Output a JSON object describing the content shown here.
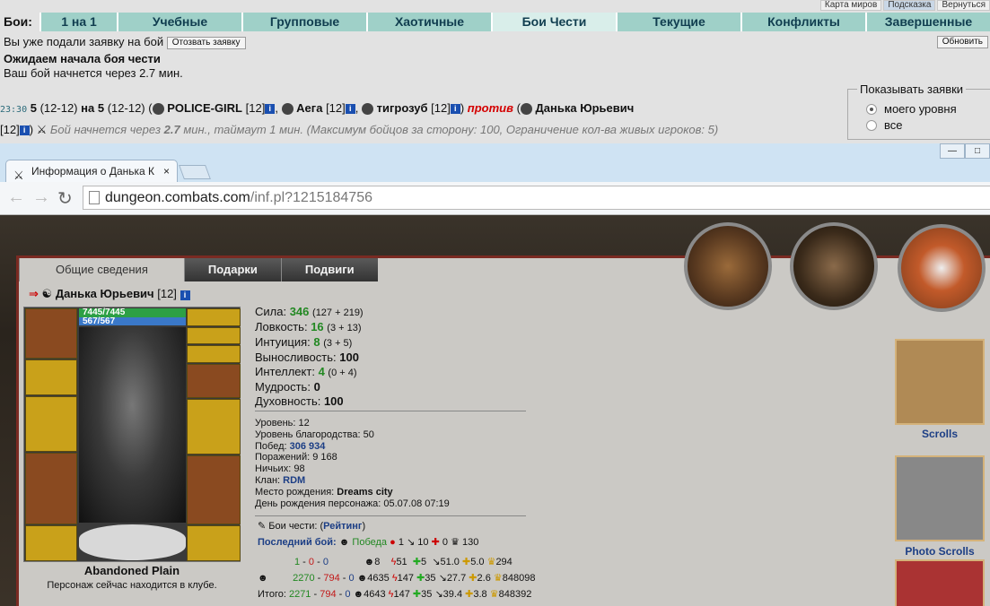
{
  "top_links": [
    {
      "label": "Карта миров",
      "active": false
    },
    {
      "label": "Подсказка",
      "active": true
    },
    {
      "label": "Вернуться",
      "active": false
    }
  ],
  "battles_tabs": {
    "label": "Бои:",
    "items": [
      "1 на 1",
      "Учебные",
      "Групповые",
      "Хаотичные",
      "Бои Чести",
      "Текущие",
      "Конфликты",
      "Завершенные"
    ],
    "selected": "Бои Чести"
  },
  "status": {
    "already_applied": "Вы уже подали заявку на бой",
    "withdraw_button": "Отозвать заявку",
    "refresh_button": "Обновить",
    "waiting_title": "Ожидаем начала боя чести",
    "start_in": "Ваш бой начнется через 2.7 мин."
  },
  "battle_request": {
    "time": "23:30",
    "teams": "5",
    "team_range": "(12-12)",
    "on": "на",
    "players_left": [
      {
        "name": "POLICE-GIRL",
        "level": "[12]"
      },
      {
        "name": "Аега",
        "level": "[12]"
      },
      {
        "name": "тигрозуб",
        "level": "[12]"
      }
    ],
    "vs": "против",
    "players_right": [
      {
        "name": "Данька Юрьевич",
        "level": "[12]"
      }
    ],
    "note_prefix": "Бой начнется через",
    "note_value": "2.7",
    "note_suffix": "мин., таймаут 1 мин. (Максимум бойцов за сторону: 100, Ограничение кол-ва живых игроков: 5)"
  },
  "show_requests": {
    "legend": "Показывать заявки",
    "options": [
      {
        "label": "моего уровня",
        "checked": true
      },
      {
        "label": "все",
        "checked": false
      }
    ]
  },
  "browser": {
    "tab_title": "Информация о Данька К",
    "tab_close": "×",
    "url_host": "dungeon.combats.com",
    "url_path": "/inf.pl?1215184756"
  },
  "profile": {
    "tabs": [
      "Общие сведения",
      "Подарки",
      "Подвиги"
    ],
    "selected_tab": "Общие сведения",
    "name": "Данька Юрьевич",
    "level": "[12]",
    "hp": "7445/7445",
    "mp": "567/567",
    "location": "Abandoned Plain",
    "location_note": "Персонаж сейчас находится в клубе.",
    "stats": [
      {
        "label": "Сила:",
        "value": "346",
        "extra": "(127 + 219)"
      },
      {
        "label": "Ловкость:",
        "value": "16",
        "extra": "(3 + 13)"
      },
      {
        "label": "Интуиция:",
        "value": "8",
        "extra": "(3 + 5)"
      },
      {
        "label": "Выносливость:",
        "value": "100",
        "extra": ""
      },
      {
        "label": "Интеллект:",
        "value": "4",
        "extra": "(0 + 4)"
      },
      {
        "label": "Мудрость:",
        "value": "0",
        "extra": ""
      },
      {
        "label": "Духовность:",
        "value": "100",
        "extra": ""
      }
    ],
    "info": [
      {
        "label": "Уровень:",
        "value": "12"
      },
      {
        "label": "Уровень благородства:",
        "value": "50"
      },
      {
        "label": "Побед:",
        "value": "306 934"
      },
      {
        "label": "Поражений:",
        "value": "9 168"
      },
      {
        "label": "Ничьих:",
        "value": "98"
      },
      {
        "label": "Клан:",
        "value": "RDM"
      },
      {
        "label": "Место рождения:",
        "value": "Dreams city"
      },
      {
        "label": "День рождения персонажа:",
        "value": "05.07.08 07:19"
      }
    ],
    "honor_label": "Бои чести:",
    "honor_link": "Рейтинг",
    "last_battle_label": "Последний бой:",
    "last_battle_result": "Победа",
    "last_battle_vals": [
      "1",
      "10",
      "0",
      "130"
    ],
    "score_rows": [
      {
        "a": "1",
        "b": "0",
        "c": "0",
        "v1": "8",
        "v2": "51",
        "v3": "5",
        "v4": "51.0",
        "v5": "5.0",
        "v6": "294"
      },
      {
        "a": "2270",
        "b": "794",
        "c": "0",
        "v1": "4635",
        "v2": "147",
        "v3": "35",
        "v4": "27.7",
        "v5": "2.6",
        "v6": "848098"
      },
      {
        "label": "Итого:",
        "a": "2271",
        "b": "794",
        "c": "0",
        "v1": "4643",
        "v2": "147",
        "v3": "35",
        "v4": "39.4",
        "v5": "3.8",
        "v6": "848392"
      }
    ],
    "side_links": [
      "Scrolls",
      "Photo Scrolls"
    ]
  }
}
